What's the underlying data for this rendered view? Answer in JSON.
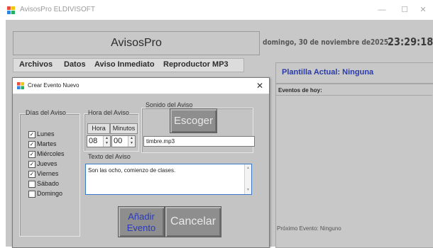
{
  "window": {
    "title": "AvisosPro ELDIVISOFT",
    "icon": "app-icon",
    "controls": {
      "minimize": "—",
      "maximize": "☐",
      "close": "✕"
    }
  },
  "header": {
    "app_name": "AvisosPro",
    "date": "domingo, 30 de noviembre de2025",
    "time": "23:29:18"
  },
  "menu": {
    "items": [
      {
        "label": "Archivos"
      },
      {
        "label": "Datos"
      },
      {
        "label": "Aviso Inmediato"
      },
      {
        "label": "Reproductor MP3"
      }
    ]
  },
  "side_panel": {
    "plantilla": "Plantilla Actual: Ninguna",
    "eventos_title": "Eventos de hoy:",
    "proximo": "Próximo Evento: Ninguno"
  },
  "dialog": {
    "title": "Crear Evento Nuevo",
    "close": "✕",
    "days_group": {
      "label": "Días del Aviso",
      "days": [
        {
          "label": "Lunes",
          "checked": true
        },
        {
          "label": "Martes",
          "checked": true
        },
        {
          "label": "Miércoles",
          "checked": true
        },
        {
          "label": "Jueves",
          "checked": true
        },
        {
          "label": "Viernes",
          "checked": true
        },
        {
          "label": "Sábado",
          "checked": false
        },
        {
          "label": "Domingo",
          "checked": false
        }
      ]
    },
    "time_group": {
      "label": "Hora del Aviso",
      "hora_btn": "Hora",
      "minutos_btn": "Minutos",
      "hour_value": "08",
      "minute_value": "00"
    },
    "sound_group": {
      "label": "Sonido del Aviso",
      "choose_btn": "Escoger",
      "file": "timbre.mp3"
    },
    "text_group": {
      "label": "Texto del Aviso",
      "value": "Son las ocho, comienzo de clases."
    },
    "buttons": {
      "add_line1": "Añadir",
      "add_line2": "Evento",
      "cancel": "Cancelar"
    }
  },
  "colors": {
    "background": "#c8c8c8",
    "accent_blue": "#2a3aa8",
    "button_gray": "#8e8e8e"
  }
}
